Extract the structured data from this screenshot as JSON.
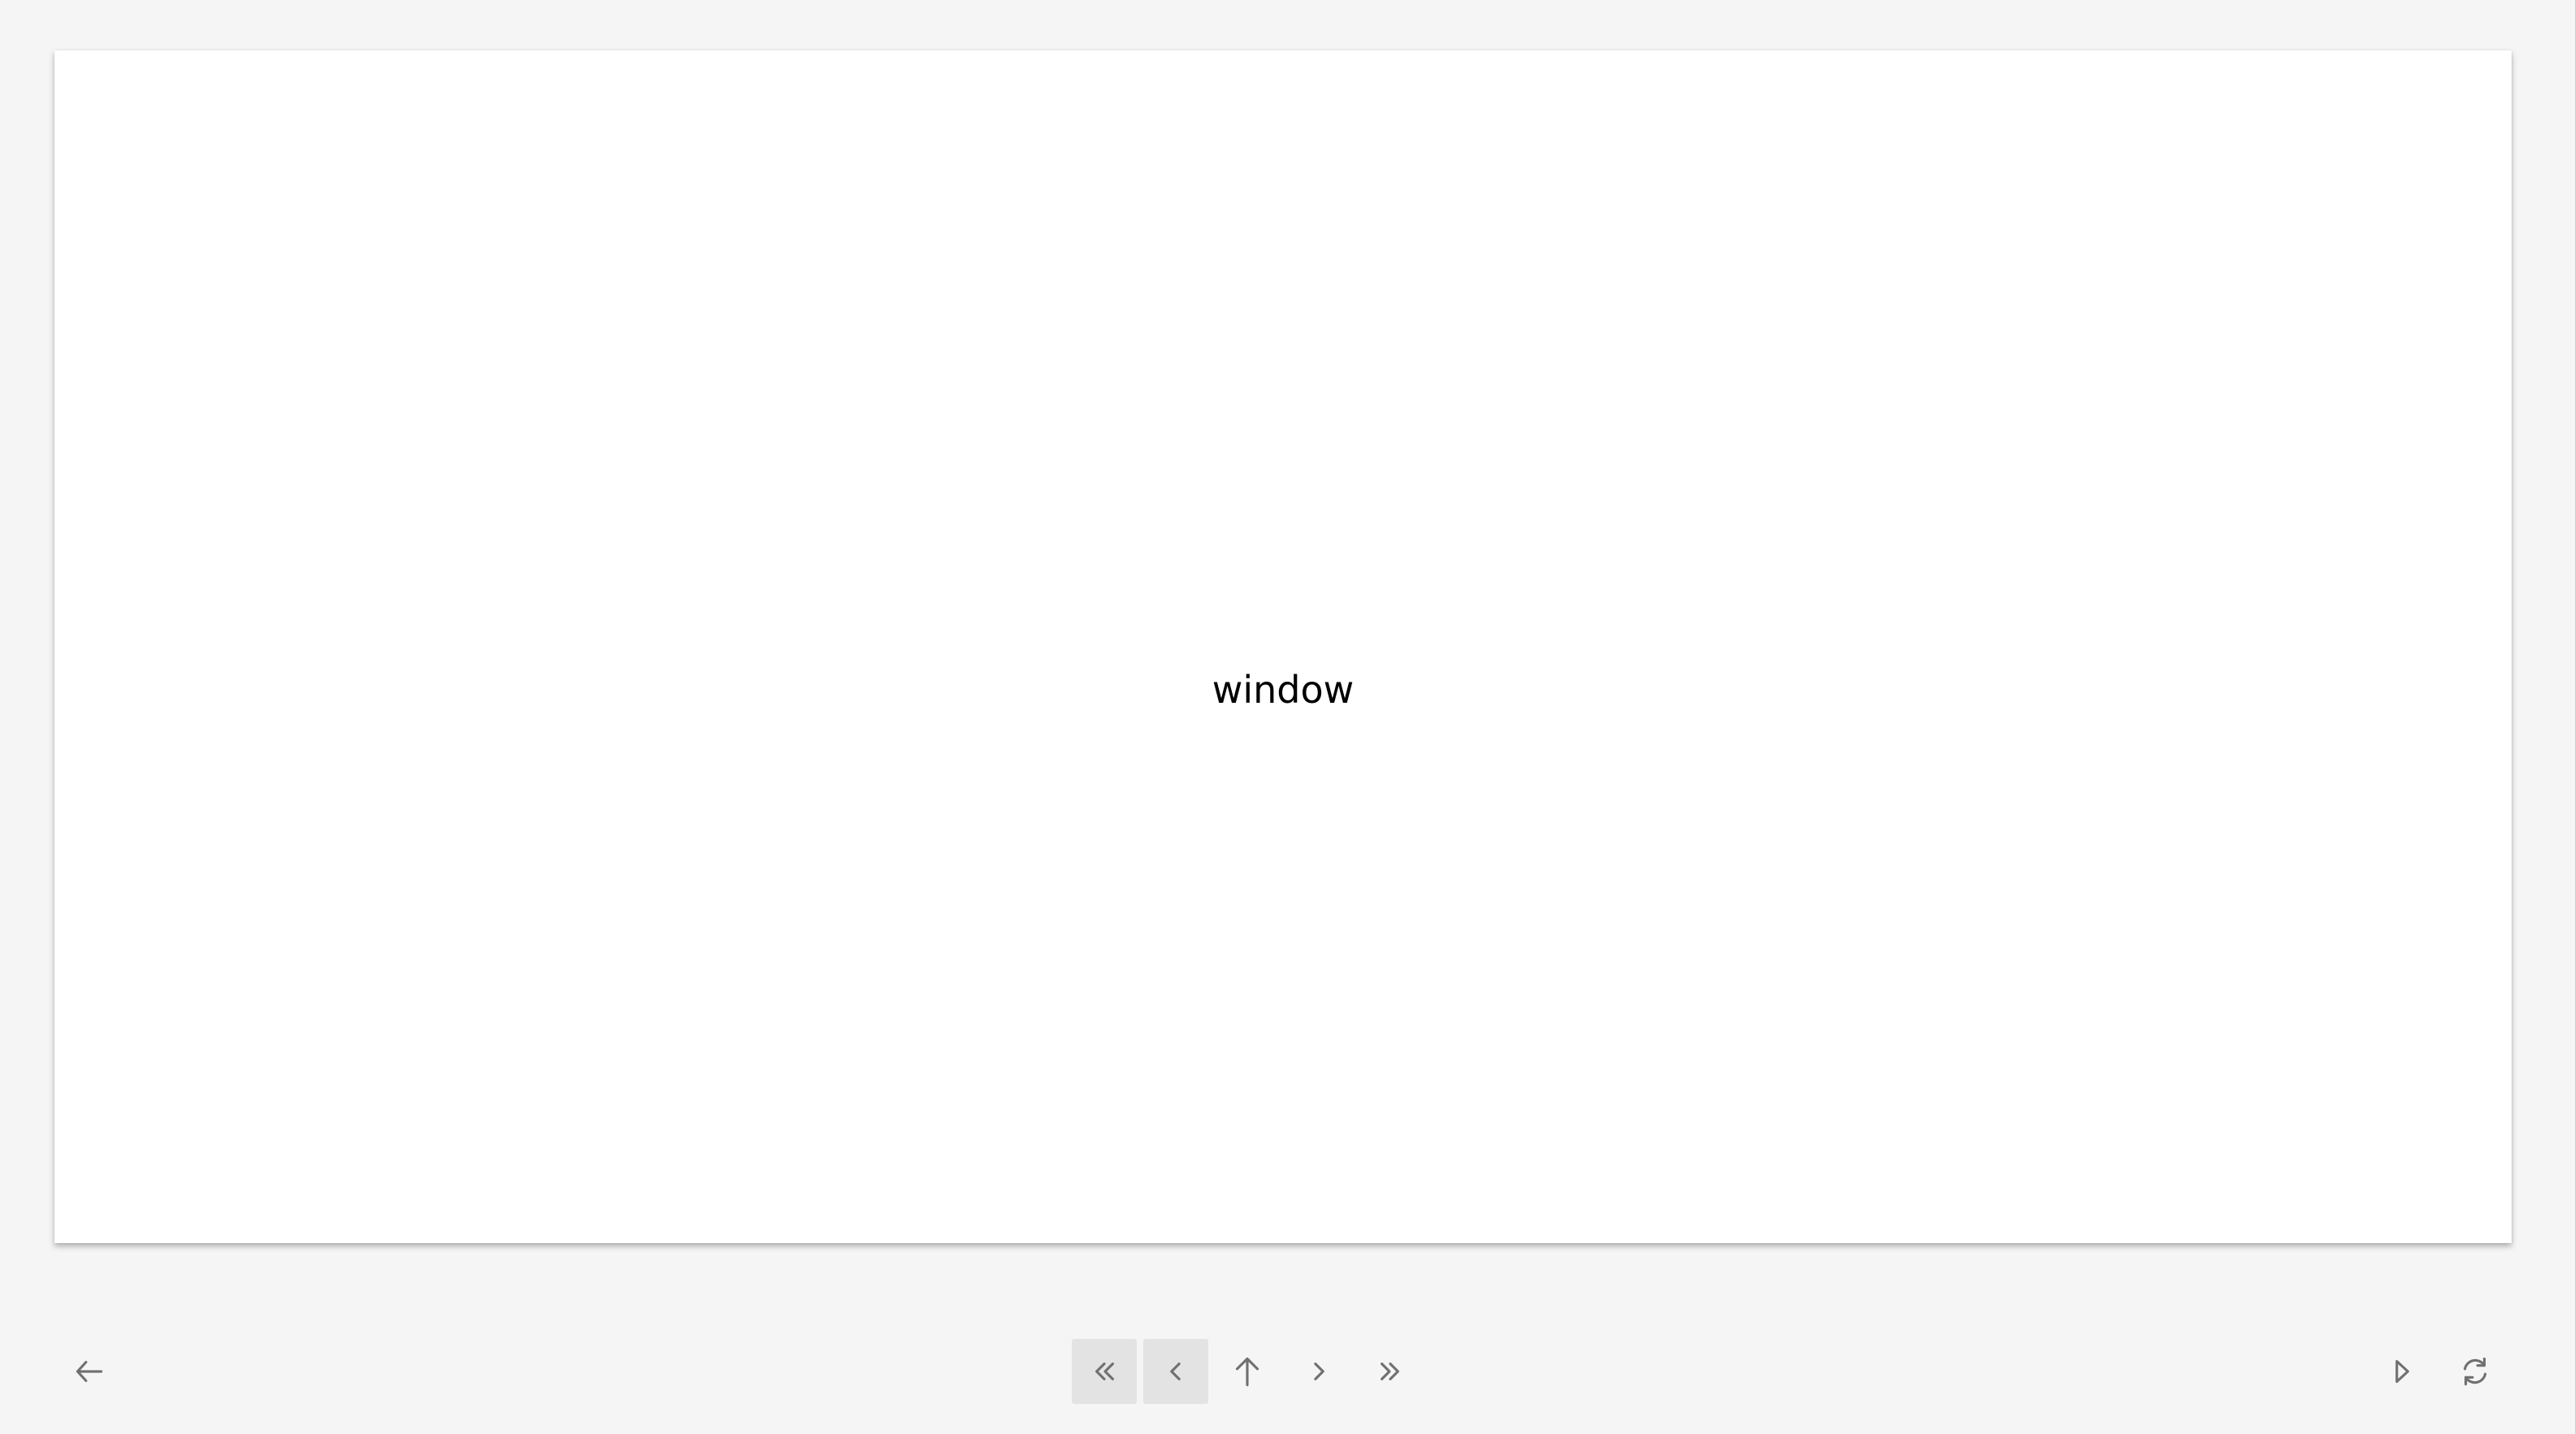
{
  "slide": {
    "text": "window"
  },
  "toolbar": {
    "back": {
      "icon": "arrow-left-icon"
    },
    "first": {
      "icon": "double-chevron-left-icon",
      "state": "disabled"
    },
    "prev": {
      "icon": "chevron-left-icon",
      "state": "disabled"
    },
    "up": {
      "icon": "arrow-up-icon"
    },
    "next": {
      "icon": "chevron-right-icon"
    },
    "last": {
      "icon": "double-chevron-right-icon"
    },
    "play": {
      "icon": "play-outline-icon"
    },
    "refresh": {
      "icon": "refresh-icon"
    }
  },
  "colors": {
    "background": "#f5f5f5",
    "card": "#ffffff",
    "icon": "#707070",
    "disabled_button": "#e3e3e3"
  }
}
